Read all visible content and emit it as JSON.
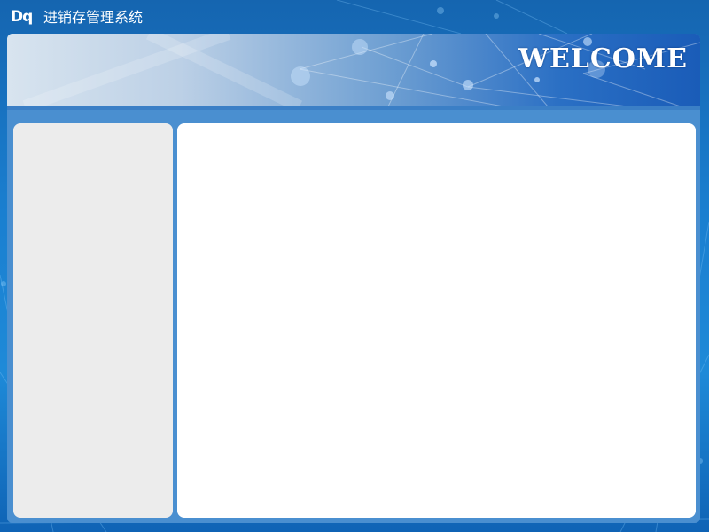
{
  "app": {
    "logo_text": "Dq",
    "title": "进销存管理系统"
  },
  "banner": {
    "welcome_text": "WELCOME"
  },
  "colors": {
    "background": "#1a7fd0",
    "frame": "#4a8fd0",
    "sidebar": "#ececec",
    "content": "#ffffff"
  }
}
